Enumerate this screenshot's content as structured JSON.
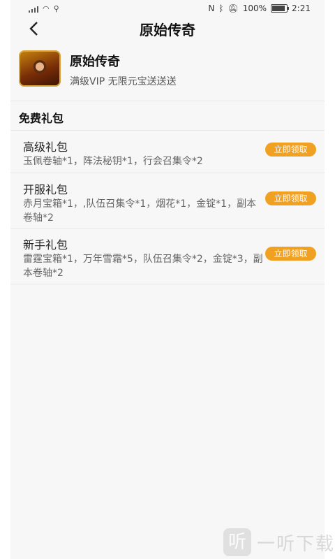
{
  "status_bar": {
    "battery": "100%",
    "time": "2:21"
  },
  "nav": {
    "back_icon": "chevron-left",
    "title": "原始传奇"
  },
  "game": {
    "name": "原始传奇",
    "description": "满级VIP 无限元宝送送送"
  },
  "section": {
    "title": "免费礼包"
  },
  "gifts": [
    {
      "name": "高级礼包",
      "items": "玉佩卷轴*1，阵法秘钥*1，行会召集令*2",
      "button": "立即领取"
    },
    {
      "name": "开服礼包",
      "items": "赤月宝箱*1，,队伍召集令*1，烟花*1，金锭*1，副本卷轴*2",
      "button": "立即领取"
    },
    {
      "name": "新手礼包",
      "items": "雷霆宝箱*1，万年雪霜*5，队伍召集令*2，金锭*3，副本卷轴*2",
      "button": "立即领取"
    }
  ],
  "watermark": {
    "logo_char": "听",
    "text": "一听下载"
  },
  "colors": {
    "accent": "#f0a122",
    "background": "#f7f7f7"
  }
}
